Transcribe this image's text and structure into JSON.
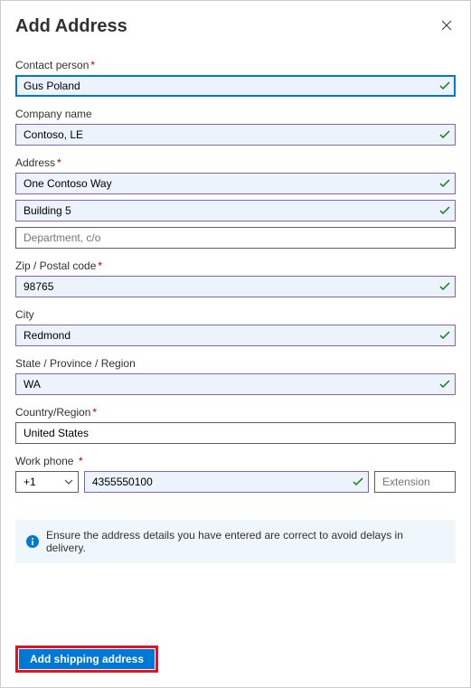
{
  "header": {
    "title": "Add Address"
  },
  "fields": {
    "contactPerson": {
      "label": "Contact person",
      "value": "Gus Poland",
      "required": true
    },
    "companyName": {
      "label": "Company name",
      "value": "Contoso, LE",
      "required": false
    },
    "address": {
      "label": "Address",
      "required": true,
      "line1": "One Contoso Way",
      "line2": "Building 5",
      "line3_placeholder": "Department, c/o"
    },
    "postalCode": {
      "label": "Zip / Postal code",
      "value": "98765",
      "required": true
    },
    "city": {
      "label": "City",
      "value": "Redmond",
      "required": false
    },
    "state": {
      "label": "State / Province / Region",
      "value": "WA",
      "required": false
    },
    "country": {
      "label": "Country/Region",
      "value": "United States",
      "required": true
    },
    "workPhone": {
      "label": "Work phone",
      "required": true,
      "prefix": "+1",
      "number": "4355550100",
      "ext_placeholder": "Extension"
    }
  },
  "info": {
    "message": "Ensure the address details you have entered are correct to avoid delays in delivery."
  },
  "footer": {
    "submit_label": "Add shipping address"
  }
}
